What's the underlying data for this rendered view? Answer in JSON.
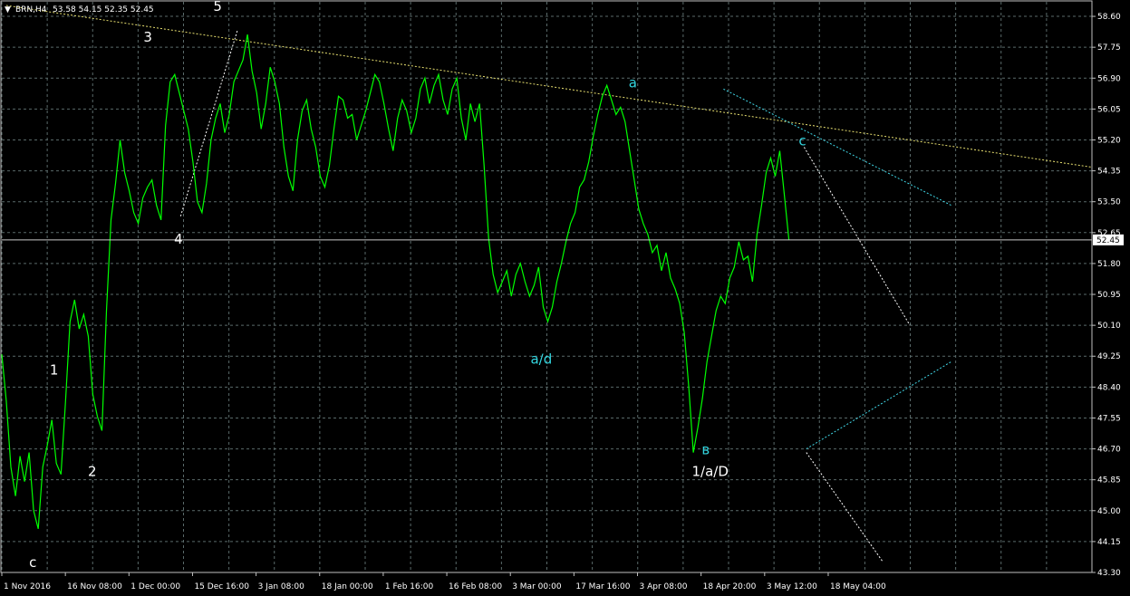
{
  "header": {
    "symbol": "BRN,H4",
    "ohlc": "53.58 54.15 52.35 52.45",
    "menu_glyph": "▼"
  },
  "colors": {
    "background": "#000000",
    "price": "#00ff00",
    "grid": "#5a6a6a",
    "axis": "#c0c0c0",
    "trend_yellow": "#e8e070",
    "trend_cyan": "#40d8e8",
    "trend_white": "#ffffff",
    "label_cyan": "#33d6e0"
  },
  "chart_data": {
    "type": "line",
    "title": "BRN,H4",
    "ylim": [
      43.3,
      59.0
    ],
    "y_ticks": [
      58.6,
      57.75,
      56.9,
      56.05,
      55.2,
      54.35,
      53.5,
      52.65,
      51.8,
      50.95,
      50.1,
      49.25,
      48.4,
      47.55,
      46.7,
      45.85,
      45.0,
      44.15,
      43.3
    ],
    "y_tick_labels": [
      "58.60",
      "57.75",
      "56.90",
      "56.05",
      "55.20",
      "54.35",
      "53.50",
      "52.65",
      "51.80",
      "50.95",
      "50.10",
      "49.25",
      "48.40",
      "47.55",
      "46.70",
      "45.85",
      "45.00",
      "44.15",
      "43.30"
    ],
    "x_tick_labels": [
      "1 Nov 2016",
      "16 Nov 08:00",
      "1 Dec 00:00",
      "15 Dec 16:00",
      "3 Jan 08:00",
      "18 Jan 00:00",
      "1 Feb 16:00",
      "16 Feb 08:00",
      "3 Mar 00:00",
      "17 Mar 16:00",
      "3 Apr 08:00",
      "18 Apr 20:00",
      "3 May 12:00",
      "18 May 04:00"
    ],
    "current_price": 52.45,
    "current_price_label": "52.45",
    "grid": true,
    "series": [
      {
        "values": [
          49.3,
          48.0,
          46.2,
          45.4,
          46.5,
          45.8,
          46.6,
          45.0,
          44.5,
          46.2,
          46.8,
          47.5,
          46.3,
          46.0,
          48.0,
          50.2,
          50.8,
          50.0,
          50.4,
          49.8,
          48.2,
          47.6,
          47.2,
          50.5,
          53.0,
          54.0,
          55.2,
          54.3,
          53.8,
          53.2,
          52.9,
          53.6,
          53.9,
          54.1,
          53.4,
          53.0,
          55.6,
          56.8,
          57.0,
          56.5,
          56.0,
          55.5,
          54.6,
          53.5,
          53.2,
          54.0,
          55.2,
          55.8,
          56.2,
          55.4,
          55.9,
          56.8,
          57.1,
          57.4,
          58.1,
          57.1,
          56.5,
          55.5,
          56.2,
          57.2,
          56.8,
          56.2,
          55.0,
          54.2,
          53.8,
          55.2,
          56.0,
          56.3,
          55.5,
          55.0,
          54.2,
          53.9,
          54.5,
          55.5,
          56.4,
          56.3,
          55.8,
          55.9,
          55.2,
          55.6,
          56.0,
          56.5,
          57.0,
          56.8,
          56.2,
          55.5,
          54.9,
          55.8,
          56.3,
          56.0,
          55.4,
          55.8,
          56.6,
          56.9,
          56.2,
          56.7,
          57.0,
          56.3,
          55.9,
          56.6,
          56.9,
          55.8,
          55.2,
          56.2,
          55.7,
          56.2,
          54.5,
          52.5,
          51.5,
          51.0,
          51.3,
          51.6,
          50.9,
          51.5,
          51.8,
          51.3,
          50.9,
          51.2,
          51.7,
          50.6,
          50.2,
          50.6,
          51.3,
          51.8,
          52.4,
          52.9,
          53.2,
          53.9,
          54.1,
          54.6,
          55.3,
          55.9,
          56.4,
          56.7,
          56.3,
          55.9,
          56.1,
          55.7,
          54.9,
          54.1,
          53.3,
          52.9,
          52.6,
          52.1,
          52.3,
          51.6,
          52.1,
          51.4,
          51.1,
          50.7,
          49.9,
          48.4,
          46.6,
          47.3,
          48.1,
          49.1,
          49.8,
          50.5,
          50.9,
          50.7,
          51.4,
          51.7,
          52.4,
          51.9,
          52.0,
          51.3,
          52.6,
          53.4,
          54.3,
          54.7,
          54.2,
          54.9,
          53.7,
          52.45
        ]
      }
    ],
    "trendlines": [
      {
        "color": "yellow",
        "points": [
          [
            0.004,
            58.9
          ],
          [
            1.0,
            54.45
          ]
        ]
      },
      {
        "color": "cyan",
        "points": [
          [
            0.662,
            56.6
          ],
          [
            0.871,
            53.4
          ]
        ]
      },
      {
        "color": "cyan",
        "points": [
          [
            0.738,
            46.7
          ],
          [
            0.871,
            49.1
          ]
        ]
      },
      {
        "color": "white",
        "points": [
          [
            0.736,
            55.0
          ],
          [
            0.833,
            50.1
          ]
        ]
      },
      {
        "color": "white",
        "points": [
          [
            0.738,
            46.6
          ],
          [
            0.808,
            43.6
          ]
        ]
      },
      {
        "color": "white",
        "points": [
          [
            0.164,
            53.1
          ],
          [
            0.216,
            58.2
          ]
        ]
      }
    ],
    "annotations": [
      {
        "text": "c",
        "x": 0.025,
        "y": 43.45,
        "color": "white"
      },
      {
        "text": "1",
        "x": 0.044,
        "y": 48.75,
        "color": "white"
      },
      {
        "text": "2",
        "x": 0.079,
        "y": 45.95,
        "color": "white"
      },
      {
        "text": "3",
        "x": 0.13,
        "y": 57.9,
        "color": "white"
      },
      {
        "text": "4",
        "x": 0.158,
        "y": 52.35,
        "color": "white"
      },
      {
        "text": "5",
        "x": 0.194,
        "y": 58.75,
        "color": "white"
      },
      {
        "text": "a",
        "x": 0.575,
        "y": 56.65,
        "color": "cyan"
      },
      {
        "text": "a/d",
        "x": 0.485,
        "y": 49.05,
        "color": "cyan"
      },
      {
        "text": "c",
        "x": 0.731,
        "y": 55.05,
        "color": "cyan"
      },
      {
        "text": "в",
        "x": 0.642,
        "y": 46.55,
        "color": "cyan"
      },
      {
        "text": "1/a/D",
        "x": 0.633,
        "y": 45.95,
        "color": "white"
      }
    ]
  }
}
